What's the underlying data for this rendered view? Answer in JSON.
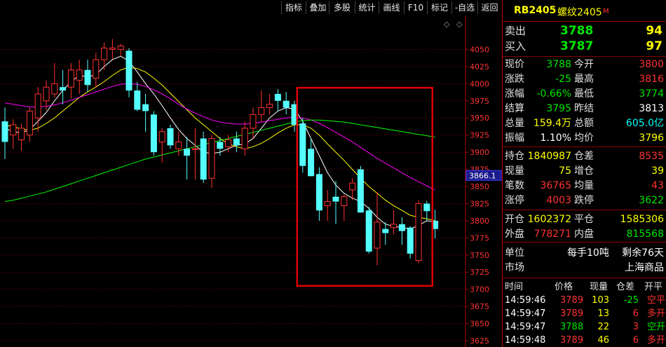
{
  "toolbar": {
    "buttons": [
      "指标",
      "叠加",
      "多股",
      "统计",
      "画线",
      "F10",
      "标记",
      "-自选",
      "返回"
    ]
  },
  "header": {
    "code": "RB2405",
    "name": "螺纹2405",
    "badge": "M",
    "diamond": "◇",
    "marker": "◇"
  },
  "quote": {
    "sell_label": "卖出",
    "sell_price": "3788",
    "sell_vol": "94",
    "buy_label": "买入",
    "buy_price": "3787",
    "buy_vol": "97",
    "rows": [
      {
        "l1": "现价",
        "v1": "3788",
        "c1": "green",
        "l2": "今开",
        "v2": "3800",
        "c2": "red"
      },
      {
        "l1": "涨跌",
        "v1": "-25",
        "c1": "green",
        "l2": "最高",
        "v2": "3816",
        "c2": "red"
      },
      {
        "l1": "涨幅",
        "v1": "-0.66%",
        "c1": "green",
        "l2": "最低",
        "v2": "3774",
        "c2": "green"
      },
      {
        "l1": "结算",
        "v1": "3795",
        "c1": "green",
        "l2": "昨结",
        "v2": "3813",
        "c2": "white"
      },
      {
        "l1": "总量",
        "v1": "159.4万",
        "c1": "yellow",
        "l2": "总额",
        "v2": "605.0亿",
        "c2": "cyan"
      },
      {
        "l1": "振幅",
        "v1": "1.10%",
        "c1": "white",
        "l2": "均价",
        "v2": "3796",
        "c2": "yellow"
      }
    ],
    "rows2": [
      {
        "l1": "持仓",
        "v1": "1840987",
        "c1": "yellow",
        "l2": "仓差",
        "v2": "8535",
        "c2": "red"
      },
      {
        "l1": "现量",
        "v1": "75",
        "c1": "yellow",
        "l2": "增仓",
        "v2": "39",
        "c2": "yellow"
      },
      {
        "l1": "笔数",
        "v1": "36765",
        "c1": "red",
        "l2": "均量",
        "v2": "43",
        "c2": "red"
      },
      {
        "l1": "涨停",
        "v1": "4003",
        "c1": "red",
        "l2": "跌停",
        "v2": "3622",
        "c2": "green"
      }
    ],
    "rows3": [
      {
        "l1": "开仓",
        "v1": "1602372",
        "c1": "yellow",
        "l2": "平仓",
        "v2": "1585306",
        "c2": "yellow"
      },
      {
        "l1": "外盘",
        "v1": "778271",
        "c1": "red",
        "l2": "内盘",
        "v2": "815568",
        "c2": "green"
      }
    ],
    "unit_label": "单位",
    "unit_value": "每手10吨",
    "remain": "剩余76天",
    "market_label": "市场",
    "market_value": "上海商品"
  },
  "ticks": {
    "headers": [
      "时间",
      "价格",
      "现量",
      "仓差",
      "开平"
    ],
    "rows": [
      {
        "time": "14:59:46",
        "price": "3789",
        "vol": "103",
        "diff": "-25",
        "type": "空平",
        "tc": "red"
      },
      {
        "time": "14:59:47",
        "price": "3789",
        "vol": "13",
        "diff": "6",
        "type": "多开",
        "tc": "red"
      },
      {
        "time": "14:59:47",
        "price": "3788",
        "vol": "22",
        "diff": "3",
        "type": "空开",
        "tc": "green"
      },
      {
        "time": "14:59:48",
        "price": "3789",
        "vol": "46",
        "diff": "6",
        "type": "多开",
        "tc": "red"
      }
    ]
  },
  "colors": {
    "up": "#ff3232",
    "down": "#54ffff",
    "ma1": "#ffffff",
    "ma2": "#ffff00",
    "ma3": "#ff00ff",
    "ma4": "#00ff00",
    "highlight_box": "#e00000",
    "grid": "#8b0000"
  },
  "chart_data": {
    "type": "candlestick",
    "ylim": [
      3625,
      4075
    ],
    "yticks": [
      3625,
      3650,
      3675,
      3700,
      3725,
      3750,
      3775,
      3800,
      3825,
      3850,
      3875,
      3900,
      3925,
      3950,
      3975,
      4000,
      4025,
      4050
    ],
    "current_price_label": "3866.1",
    "current_price": 3866.1,
    "highlight_range": {
      "from_index": 36,
      "to_index": 51,
      "price_low": 3705,
      "price_high": 3994
    },
    "candles": [
      {
        "o": 3945,
        "h": 3965,
        "l": 3890,
        "c": 3915
      },
      {
        "o": 3925,
        "h": 3948,
        "l": 3905,
        "c": 3940
      },
      {
        "o": 3918,
        "h": 3942,
        "l": 3902,
        "c": 3935
      },
      {
        "o": 3925,
        "h": 3965,
        "l": 3915,
        "c": 3960
      },
      {
        "o": 3950,
        "h": 3995,
        "l": 3930,
        "c": 3985
      },
      {
        "o": 3975,
        "h": 4005,
        "l": 3962,
        "c": 3995
      },
      {
        "o": 3985,
        "h": 4030,
        "l": 3980,
        "c": 4000
      },
      {
        "o": 3995,
        "h": 4020,
        "l": 3970,
        "c": 3990
      },
      {
        "o": 3995,
        "h": 4030,
        "l": 3978,
        "c": 4020
      },
      {
        "o": 4005,
        "h": 4035,
        "l": 3985,
        "c": 4020
      },
      {
        "o": 4020,
        "h": 4035,
        "l": 3988,
        "c": 3998
      },
      {
        "o": 4008,
        "h": 4045,
        "l": 3994,
        "c": 4035
      },
      {
        "o": 4035,
        "h": 4060,
        "l": 4020,
        "c": 4052
      },
      {
        "o": 4050,
        "h": 4065,
        "l": 4035,
        "c": 4052
      },
      {
        "o": 4050,
        "h": 4058,
        "l": 4040,
        "c": 4055
      },
      {
        "o": 4048,
        "h": 4052,
        "l": 3980,
        "c": 3990
      },
      {
        "o": 3990,
        "h": 4002,
        "l": 3960,
        "c": 3962
      },
      {
        "o": 3970,
        "h": 3985,
        "l": 3930,
        "c": 3960
      },
      {
        "o": 3955,
        "h": 3960,
        "l": 3895,
        "c": 3900
      },
      {
        "o": 3915,
        "h": 3935,
        "l": 3885,
        "c": 3930
      },
      {
        "o": 3935,
        "h": 3940,
        "l": 3905,
        "c": 3910
      },
      {
        "o": 3905,
        "h": 3930,
        "l": 3895,
        "c": 3915
      },
      {
        "o": 3905,
        "h": 3922,
        "l": 3860,
        "c": 3895
      },
      {
        "o": 3905,
        "h": 3935,
        "l": 3860,
        "c": 3905
      },
      {
        "o": 3920,
        "h": 3930,
        "l": 3855,
        "c": 3860
      },
      {
        "o": 3862,
        "h": 3925,
        "l": 3848,
        "c": 3920
      },
      {
        "o": 3915,
        "h": 3922,
        "l": 3895,
        "c": 3905
      },
      {
        "o": 3908,
        "h": 3925,
        "l": 3900,
        "c": 3918
      },
      {
        "o": 3920,
        "h": 3930,
        "l": 3900,
        "c": 3910
      },
      {
        "o": 3905,
        "h": 3945,
        "l": 3895,
        "c": 3935
      },
      {
        "o": 3935,
        "h": 3965,
        "l": 3920,
        "c": 3955
      },
      {
        "o": 3955,
        "h": 3990,
        "l": 3945,
        "c": 3965
      },
      {
        "o": 3965,
        "h": 3985,
        "l": 3955,
        "c": 3970
      },
      {
        "o": 3985,
        "h": 3992,
        "l": 3960,
        "c": 3975
      },
      {
        "o": 3975,
        "h": 3988,
        "l": 3955,
        "c": 3965
      },
      {
        "o": 3970,
        "h": 3975,
        "l": 3930,
        "c": 3940
      },
      {
        "o": 3942,
        "h": 3950,
        "l": 3870,
        "c": 3880
      },
      {
        "o": 3905,
        "h": 3918,
        "l": 3865,
        "c": 3865
      },
      {
        "o": 3868,
        "h": 3878,
        "l": 3800,
        "c": 3815
      },
      {
        "o": 3822,
        "h": 3845,
        "l": 3800,
        "c": 3828
      },
      {
        "o": 3835,
        "h": 3858,
        "l": 3795,
        "c": 3828
      },
      {
        "o": 3822,
        "h": 3838,
        "l": 3800,
        "c": 3835
      },
      {
        "o": 3845,
        "h": 3862,
        "l": 3830,
        "c": 3855
      },
      {
        "o": 3875,
        "h": 3880,
        "l": 3812,
        "c": 3812
      },
      {
        "o": 3815,
        "h": 3820,
        "l": 3752,
        "c": 3755
      },
      {
        "o": 3760,
        "h": 3842,
        "l": 3735,
        "c": 3798
      },
      {
        "o": 3788,
        "h": 3798,
        "l": 3765,
        "c": 3782
      },
      {
        "o": 3790,
        "h": 3815,
        "l": 3780,
        "c": 3795
      },
      {
        "o": 3795,
        "h": 3805,
        "l": 3765,
        "c": 3785
      },
      {
        "o": 3790,
        "h": 3792,
        "l": 3745,
        "c": 3752
      },
      {
        "o": 3742,
        "h": 3830,
        "l": 3738,
        "c": 3825
      },
      {
        "o": 3825,
        "h": 3829,
        "l": 3800,
        "c": 3814
      },
      {
        "o": 3800,
        "h": 3816,
        "l": 3774,
        "c": 3788
      }
    ],
    "ma_series": [
      {
        "color": "#ffffff",
        "values": [
          3935,
          3930,
          3928,
          3933,
          3945,
          3958,
          3975,
          3990,
          4003,
          4012,
          4010,
          4013,
          4025,
          4035,
          4040,
          4033,
          4017,
          4000,
          3985,
          3968,
          3950,
          3933,
          3920,
          3910,
          3900,
          3898,
          3900,
          3905,
          3910,
          3912,
          3920,
          3935,
          3950,
          3960,
          3965,
          3963,
          3945,
          3920,
          3895,
          3870,
          3852,
          3840,
          3833,
          3828,
          3818,
          3805,
          3795,
          3792,
          3790,
          3788,
          3793,
          3800,
          3798
        ]
      },
      {
        "color": "#ffff00",
        "values": [
          3940,
          3937,
          3934,
          3932,
          3935,
          3942,
          3950,
          3960,
          3970,
          3980,
          3988,
          3995,
          4003,
          4012,
          4020,
          4024,
          4022,
          4017,
          4008,
          3998,
          3986,
          3974,
          3962,
          3950,
          3940,
          3930,
          3920,
          3912,
          3908,
          3905,
          3908,
          3913,
          3920,
          3928,
          3935,
          3940,
          3940,
          3935,
          3925,
          3912,
          3900,
          3888,
          3875,
          3862,
          3850,
          3840,
          3830,
          3822,
          3815,
          3808,
          3805,
          3803,
          3800
        ]
      },
      {
        "color": "#ff00ff",
        "values": [
          3972,
          3970,
          3968,
          3966,
          3966,
          3967,
          3969,
          3972,
          3976,
          3980,
          3984,
          3988,
          3992,
          3996,
          3999,
          4000,
          3999,
          3996,
          3991,
          3985,
          3978,
          3970,
          3963,
          3957,
          3952,
          3947,
          3944,
          3942,
          3941,
          3941,
          3942,
          3944,
          3946,
          3948,
          3950,
          3951,
          3950,
          3947,
          3942,
          3936,
          3929,
          3922,
          3915,
          3907,
          3899,
          3891,
          3884,
          3877,
          3870,
          3863,
          3857,
          3851,
          3845
        ]
      },
      {
        "color": "#00ff00",
        "values": [
          3828,
          3830,
          3833,
          3836,
          3839,
          3842,
          3846,
          3850,
          3854,
          3858,
          3862,
          3866,
          3870,
          3874,
          3878,
          3882,
          3886,
          3890,
          3893,
          3896,
          3899,
          3902,
          3905,
          3908,
          3911,
          3914,
          3917,
          3920,
          3923,
          3926,
          3929,
          3932,
          3935,
          3938,
          3941,
          3944,
          3946,
          3947,
          3947,
          3946,
          3945,
          3944,
          3942,
          3940,
          3938,
          3936,
          3934,
          3932,
          3930,
          3928,
          3926,
          3924,
          3922
        ]
      }
    ]
  }
}
